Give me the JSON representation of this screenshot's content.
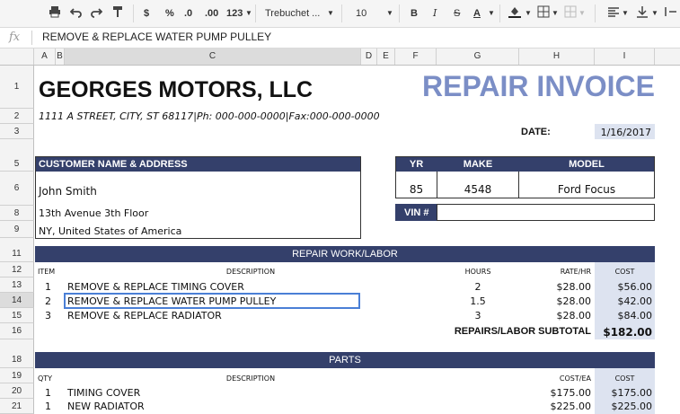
{
  "toolbar": {
    "print_icon": "printer-icon",
    "currency": "$",
    "percent": "%",
    "dec_less": ".0",
    "dec_more": ".00",
    "format_more": "123",
    "font": "Trebuchet ...",
    "font_size": "10",
    "bold": "B",
    "italic": "I",
    "strike": "S",
    "text_color": "A"
  },
  "formula_bar": {
    "fx": "fx",
    "content": "REMOVE & REPLACE WATER PUMP PULLEY"
  },
  "columns": [
    "A",
    "B",
    "C",
    "D",
    "E",
    "F",
    "G",
    "H",
    "I"
  ],
  "rows": [
    "1",
    "2",
    "3",
    "5",
    "6",
    "8",
    "9",
    "11",
    "12",
    "13",
    "14",
    "15",
    "16",
    "18",
    "19",
    "20",
    "21"
  ],
  "invoice": {
    "company": "GEORGES MOTORS, LLC",
    "title": "REPAIR INVOICE",
    "address": "1111 A STREET, CITY, ST  68117|Ph: 000-000-0000|Fax:000-000-0000",
    "date_label": "DATE:",
    "date_value": "1/16/2017",
    "customer_header": "CUSTOMER NAME & ADDRESS",
    "customer_name": "John Smith",
    "customer_addr1": "13th Avenue 3th Floor",
    "customer_addr2": "NY, United States of America",
    "vehicle": {
      "yr_label": "YR",
      "make_label": "MAKE",
      "model_label": "MODEL",
      "yr": "85",
      "make": "4548",
      "model": "Ford Focus",
      "vin_label": "VIN #"
    },
    "labor": {
      "header": "REPAIR WORK/LABOR",
      "col_item": "ITEM",
      "col_desc": "DESCRIPTION",
      "col_hours": "HOURS",
      "col_rate": "RATE/HR",
      "col_cost": "COST",
      "items": [
        {
          "item": "1",
          "desc": "REMOVE & REPLACE TIMING COVER",
          "hours": "2",
          "rate": "$28.00",
          "cost": "$56.00"
        },
        {
          "item": "2",
          "desc": "REMOVE & REPLACE WATER PUMP PULLEY",
          "hours": "1.5",
          "rate": "$28.00",
          "cost": "$42.00"
        },
        {
          "item": "3",
          "desc": "REMOVE & REPLACE RADIATOR",
          "hours": "3",
          "rate": "$28.00",
          "cost": "$84.00"
        }
      ],
      "subtotal_label": "REPAIRS/LABOR SUBTOTAL",
      "subtotal": "$182.00"
    },
    "parts": {
      "header": "PARTS",
      "col_qty": "QTY",
      "col_desc": "DESCRIPTION",
      "col_costea": "COST/EA",
      "col_cost": "COST",
      "items": [
        {
          "qty": "1",
          "desc": "TIMING COVER",
          "costea": "$175.00",
          "cost": "$175.00"
        },
        {
          "qty": "1",
          "desc": "NEW RADIATOR",
          "costea": "$225.00",
          "cost": "$225.00"
        }
      ]
    }
  },
  "colors": {
    "header_navy": "#34406b",
    "title_blue": "#7b8ec6",
    "cost_bg": "#dde3f0",
    "selection": "#4a7fd6"
  }
}
